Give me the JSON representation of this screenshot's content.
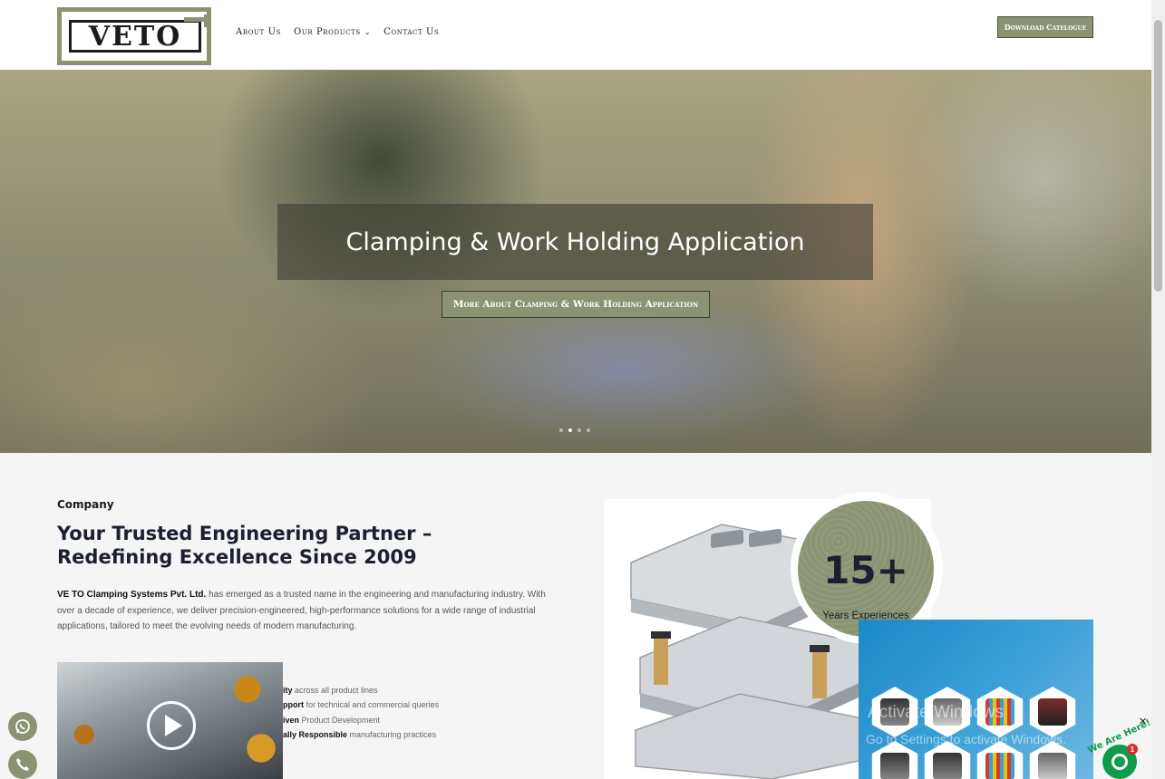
{
  "brand": {
    "logo_text": "VETO",
    "accent_color": "#8a9472"
  },
  "nav": {
    "items": [
      {
        "label": "About Us"
      },
      {
        "label": "Our Products",
        "icon": "chevron-down-icon"
      },
      {
        "label": "Contact Us"
      }
    ],
    "cta_label": "Download Catelogue"
  },
  "hero": {
    "title": "Clamping & Work Holding Application",
    "button_label": "More About Clamping & Work Holding Application",
    "slides_count": 4,
    "active_slide": 2
  },
  "company": {
    "label": "Company",
    "title": "Your Trusted Engineering Partner – Redefining Excellence Since 2009",
    "desc_strong": "VE TO Clamping Systems Pvt. Ltd.",
    "desc_rest": " has emerged as a trusted name in the engineering and manufacturing industry. With over a decade of experience, we deliver precision-engineered, high-performance solutions for a wide range of industrial applications, tailored to meet the evolving needs of modern manufacturing.",
    "features": [
      {
        "strong": "ity",
        "rest": " across all product lines"
      },
      {
        "strong": "pport",
        "rest": " for technical and commercial queries"
      },
      {
        "strong": "iven",
        "rest": " Product Development"
      },
      {
        "strong": "ally Responsible",
        "rest": " manufacturing practices"
      }
    ]
  },
  "stats": {
    "number": "15+",
    "label": "Years Experiences"
  },
  "watermark": {
    "line1": "Activate Windows",
    "line2": "Go to Settings to activate Windows."
  },
  "chat": {
    "tag": "We Are Here!",
    "count": "1",
    "close_icon": "close-icon"
  },
  "floating": {
    "whatsapp_icon": "whatsapp-icon",
    "phone_icon": "phone-icon"
  }
}
